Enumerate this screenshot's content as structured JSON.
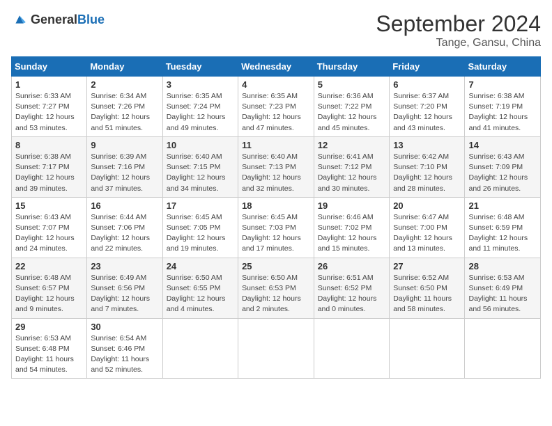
{
  "header": {
    "logo_general": "General",
    "logo_blue": "Blue",
    "month_title": "September 2024",
    "location": "Tange, Gansu, China"
  },
  "days_of_week": [
    "Sunday",
    "Monday",
    "Tuesday",
    "Wednesday",
    "Thursday",
    "Friday",
    "Saturday"
  ],
  "weeks": [
    [
      {
        "day": "1",
        "info": "Sunrise: 6:33 AM\nSunset: 7:27 PM\nDaylight: 12 hours\nand 53 minutes."
      },
      {
        "day": "2",
        "info": "Sunrise: 6:34 AM\nSunset: 7:26 PM\nDaylight: 12 hours\nand 51 minutes."
      },
      {
        "day": "3",
        "info": "Sunrise: 6:35 AM\nSunset: 7:24 PM\nDaylight: 12 hours\nand 49 minutes."
      },
      {
        "day": "4",
        "info": "Sunrise: 6:35 AM\nSunset: 7:23 PM\nDaylight: 12 hours\nand 47 minutes."
      },
      {
        "day": "5",
        "info": "Sunrise: 6:36 AM\nSunset: 7:22 PM\nDaylight: 12 hours\nand 45 minutes."
      },
      {
        "day": "6",
        "info": "Sunrise: 6:37 AM\nSunset: 7:20 PM\nDaylight: 12 hours\nand 43 minutes."
      },
      {
        "day": "7",
        "info": "Sunrise: 6:38 AM\nSunset: 7:19 PM\nDaylight: 12 hours\nand 41 minutes."
      }
    ],
    [
      {
        "day": "8",
        "info": "Sunrise: 6:38 AM\nSunset: 7:17 PM\nDaylight: 12 hours\nand 39 minutes."
      },
      {
        "day": "9",
        "info": "Sunrise: 6:39 AM\nSunset: 7:16 PM\nDaylight: 12 hours\nand 37 minutes."
      },
      {
        "day": "10",
        "info": "Sunrise: 6:40 AM\nSunset: 7:15 PM\nDaylight: 12 hours\nand 34 minutes."
      },
      {
        "day": "11",
        "info": "Sunrise: 6:40 AM\nSunset: 7:13 PM\nDaylight: 12 hours\nand 32 minutes."
      },
      {
        "day": "12",
        "info": "Sunrise: 6:41 AM\nSunset: 7:12 PM\nDaylight: 12 hours\nand 30 minutes."
      },
      {
        "day": "13",
        "info": "Sunrise: 6:42 AM\nSunset: 7:10 PM\nDaylight: 12 hours\nand 28 minutes."
      },
      {
        "day": "14",
        "info": "Sunrise: 6:43 AM\nSunset: 7:09 PM\nDaylight: 12 hours\nand 26 minutes."
      }
    ],
    [
      {
        "day": "15",
        "info": "Sunrise: 6:43 AM\nSunset: 7:07 PM\nDaylight: 12 hours\nand 24 minutes."
      },
      {
        "day": "16",
        "info": "Sunrise: 6:44 AM\nSunset: 7:06 PM\nDaylight: 12 hours\nand 22 minutes."
      },
      {
        "day": "17",
        "info": "Sunrise: 6:45 AM\nSunset: 7:05 PM\nDaylight: 12 hours\nand 19 minutes."
      },
      {
        "day": "18",
        "info": "Sunrise: 6:45 AM\nSunset: 7:03 PM\nDaylight: 12 hours\nand 17 minutes."
      },
      {
        "day": "19",
        "info": "Sunrise: 6:46 AM\nSunset: 7:02 PM\nDaylight: 12 hours\nand 15 minutes."
      },
      {
        "day": "20",
        "info": "Sunrise: 6:47 AM\nSunset: 7:00 PM\nDaylight: 12 hours\nand 13 minutes."
      },
      {
        "day": "21",
        "info": "Sunrise: 6:48 AM\nSunset: 6:59 PM\nDaylight: 12 hours\nand 11 minutes."
      }
    ],
    [
      {
        "day": "22",
        "info": "Sunrise: 6:48 AM\nSunset: 6:57 PM\nDaylight: 12 hours\nand 9 minutes."
      },
      {
        "day": "23",
        "info": "Sunrise: 6:49 AM\nSunset: 6:56 PM\nDaylight: 12 hours\nand 7 minutes."
      },
      {
        "day": "24",
        "info": "Sunrise: 6:50 AM\nSunset: 6:55 PM\nDaylight: 12 hours\nand 4 minutes."
      },
      {
        "day": "25",
        "info": "Sunrise: 6:50 AM\nSunset: 6:53 PM\nDaylight: 12 hours\nand 2 minutes."
      },
      {
        "day": "26",
        "info": "Sunrise: 6:51 AM\nSunset: 6:52 PM\nDaylight: 12 hours\nand 0 minutes."
      },
      {
        "day": "27",
        "info": "Sunrise: 6:52 AM\nSunset: 6:50 PM\nDaylight: 11 hours\nand 58 minutes."
      },
      {
        "day": "28",
        "info": "Sunrise: 6:53 AM\nSunset: 6:49 PM\nDaylight: 11 hours\nand 56 minutes."
      }
    ],
    [
      {
        "day": "29",
        "info": "Sunrise: 6:53 AM\nSunset: 6:48 PM\nDaylight: 11 hours\nand 54 minutes."
      },
      {
        "day": "30",
        "info": "Sunrise: 6:54 AM\nSunset: 6:46 PM\nDaylight: 11 hours\nand 52 minutes."
      },
      null,
      null,
      null,
      null,
      null
    ]
  ]
}
